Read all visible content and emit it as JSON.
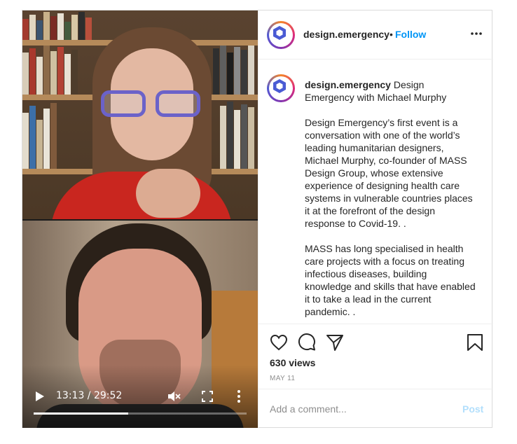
{
  "video": {
    "time_display": "13:13 / 29:52",
    "progress": 0.4425,
    "icons": {
      "play": "play-icon",
      "mute": "muted-speaker-icon",
      "fullscreen": "fullscreen-icon",
      "more": "vertical-dots-icon"
    }
  },
  "header": {
    "username": "design.emergency",
    "separator": "•",
    "follow_label": "Follow",
    "more_icon": "horizontal-dots-icon"
  },
  "caption": {
    "username": "design.emergency",
    "title": " Design Emergency with Michael Murphy",
    "paragraphs": [
      "Design Emergency’s first event is a conversation with one of the world’s leading humanitarian designers, Michael Murphy, co-founder of MASS Design Group, whose extensive experience of designing health care systems in vulnerable countries places it at the forefront of the design response to Covid-19. .",
      "MASS has long specialised in health care projects with a focus on treating infectious diseases, building knowledge and skills that have enabled it to take a lead in the current pandemic. ."
    ]
  },
  "actions": {
    "icons": [
      "heart-icon",
      "comment-icon",
      "share-icon",
      "bookmark-icon"
    ],
    "views": "630 views",
    "date": "MAY 11"
  },
  "comment": {
    "placeholder": "Add a comment...",
    "post_label": "Post"
  },
  "colors": {
    "follow": "#0095f6",
    "post_disabled": "#b2dffc",
    "muted_text": "#8e8e8e",
    "avatar_logo": "#4a5bd4"
  }
}
